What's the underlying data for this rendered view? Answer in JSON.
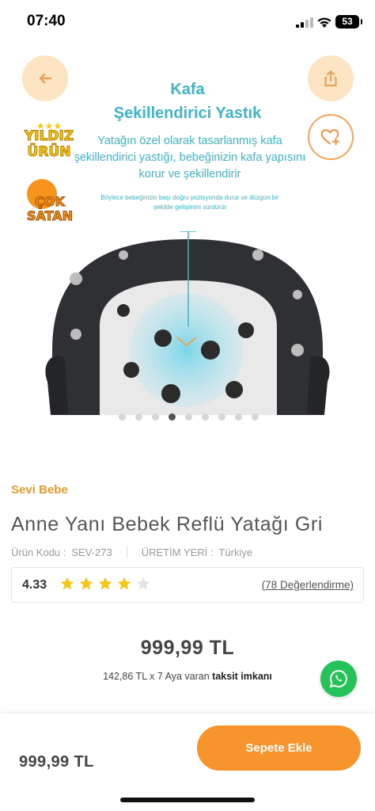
{
  "status_bar": {
    "time": "07:40",
    "battery": "53"
  },
  "hero": {
    "title_line1": "Kafa",
    "title_line2": "Şekillendirici Yastık",
    "description": "Yatağın özel olarak tasarlanmış kafa şekillendirici yastığı, bebeğinizin kafa yapısını korur ve şekillendirir",
    "small_text": "Böylece bebeğinizin başı doğru pozisyonda durur ve düzgün bir şekilde gelişimini sürdürür",
    "badge_star": "YILDIZ ÜRÜN",
    "badge_hot": "ÇOK SATAN",
    "dots_total": 9,
    "dots_active_index": 3
  },
  "product": {
    "brand": "Sevi Bebe",
    "title": "Anne Yanı Bebek Reflü Yatağı Gri",
    "code_label": "Ürün Kodu :",
    "code_value": "SEV-273",
    "origin_label": "ÜRETİM YERİ :",
    "origin_value": "Türkiye",
    "rating": "4.33",
    "stars_filled": 4,
    "stars_total": 5,
    "reviews_link": "(78 Değerlendirme)",
    "price": "999,99 TL",
    "installment_prefix": "142,86 TL x 7 Aya varan",
    "installment_bold": "taksit imkanı"
  },
  "bottom_bar": {
    "price": "999,99 TL",
    "add_to_cart": "Sepete Ekle"
  },
  "colors": {
    "accent_orange": "#f7952c",
    "brand_gold": "#e89b2d",
    "hero_teal": "#3fb4c9",
    "whatsapp_green": "#25c25a",
    "star_yellow": "#f5c518"
  },
  "icons": [
    "back-arrow-icon",
    "share-icon",
    "heart-plus-icon",
    "star-icon",
    "whatsapp-icon"
  ]
}
